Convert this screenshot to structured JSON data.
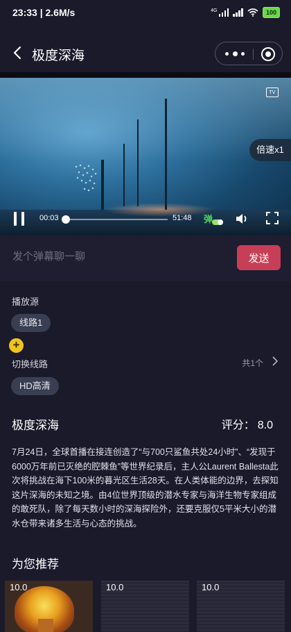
{
  "status_bar": {
    "time_speed": "23:33 | 2.6M/s",
    "signal_label": "4G",
    "battery": "100"
  },
  "navbar": {
    "title": "极度深海"
  },
  "player": {
    "current_time": "00:03",
    "total_time": "51:48",
    "progress": 0.002,
    "speed_label": "倍速x1",
    "danmu_label": "弹",
    "tv_label": "TV"
  },
  "comment": {
    "placeholder": "发个弹幕聊一聊",
    "send_label": "发送"
  },
  "source": {
    "label": "播放源",
    "options": [
      "线路1"
    ]
  },
  "line_switch": {
    "label": "切换线路",
    "count": "共1个",
    "options": [
      "HD高清"
    ]
  },
  "detail": {
    "title": "极度深海",
    "rating_label": "评分：",
    "rating_value": "8.0",
    "description": "7月24日，全球首播在接连创造了“与700只鲨鱼共处24小时”、“发现于6000万年前已灭绝的腔棘鱼”等世界纪录后，主人公Laurent Ballesta此次将挑战在海下100米的暮光区生活28天。在人类体能的边界，去探知这片深海的未知之境。由4位世界顶级的潜水专家与海洋生物专家组成的敢死队，除了每天数小时的深海探险外，还要克服仅5平米大小的潜水仓带来诸多生活与心态的挑战。"
  },
  "recommend": {
    "title": "为您推荐",
    "items": [
      {
        "score": "10.0"
      },
      {
        "score": "10.0"
      },
      {
        "score": "10.0"
      }
    ]
  },
  "colors": {
    "background": "#1a1a2b",
    "send_button": "#c73f57",
    "chip": "#3a3e52",
    "fab": "#f0c420",
    "danmu_toggle": "#9ae06a"
  },
  "icons": [
    "back-icon",
    "more-dots-icon",
    "record-target-icon",
    "tv-cast-icon",
    "pause-icon",
    "volume-icon",
    "fullscreen-icon",
    "plus-icon",
    "chevron-right-icon",
    "wifi-icon",
    "signal-icon",
    "battery-icon"
  ]
}
